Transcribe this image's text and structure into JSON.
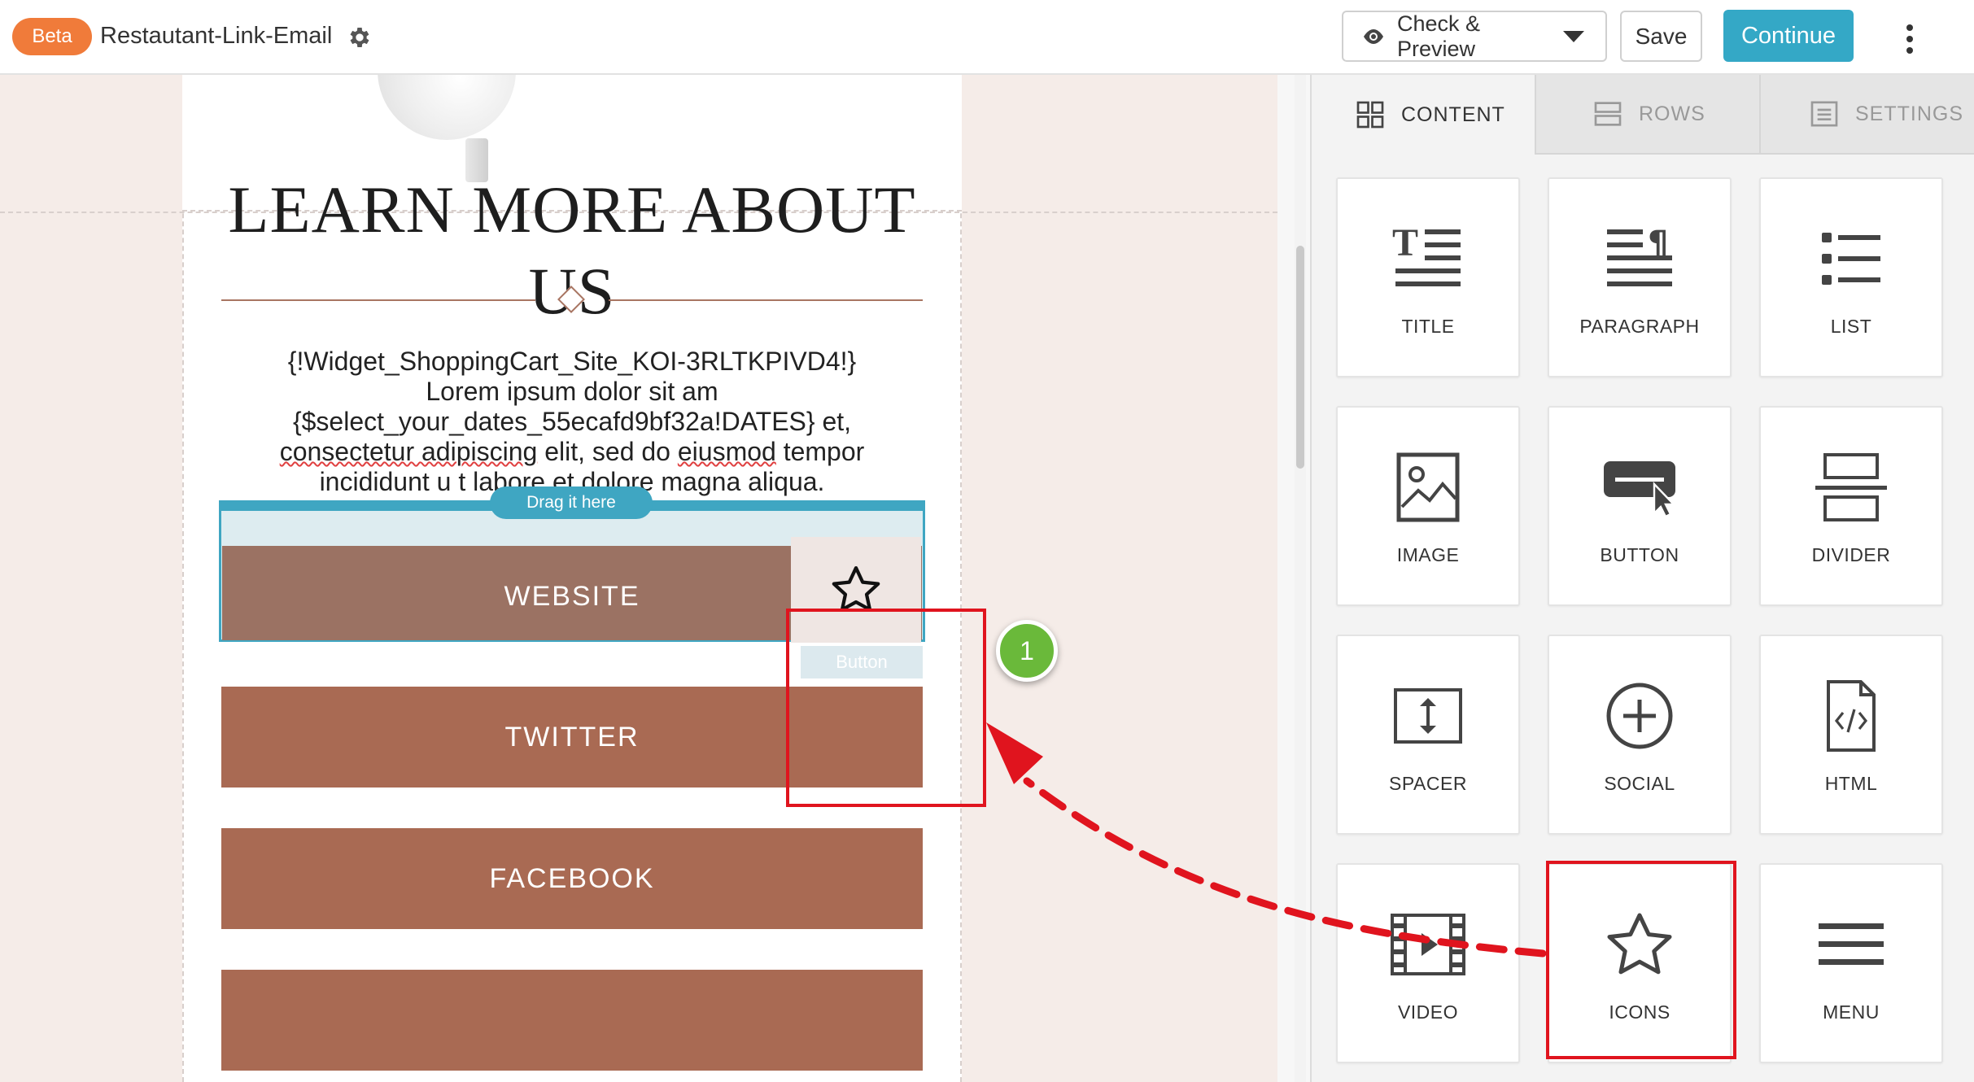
{
  "topbar": {
    "badge": "Beta",
    "title": "Restautant-Link-Email",
    "preview_label": "Check & Preview",
    "save_label": "Save",
    "continue_label": "Continue"
  },
  "email": {
    "heading": "LEARN MORE ABOUT US",
    "paragraph": {
      "line1": "{!Widget_ShoppingCart_Site_KOI-3RLTKPIVD4!}",
      "line2": "Lorem ipsum dolor sit am",
      "line3": "{$select_your_dates_55ecafd9bf32a!DATES} et,",
      "line4a": "consectetur adipiscing",
      "line4b": " elit, sed do ",
      "line4c": "eiusmod",
      "line4d": " tempor",
      "line5": "incididunt u t labore et dolore magna aliqua."
    },
    "drop_hint": "Drag it here",
    "buttons": [
      "WEBSITE",
      "TWITTER",
      "FACEBOOK",
      ""
    ],
    "ghost_label": "Button"
  },
  "annotation": {
    "step": "1"
  },
  "panel": {
    "tabs": [
      "CONTENT",
      "ROWS",
      "SETTINGS"
    ],
    "active_tab": "CONTENT",
    "tiles": [
      {
        "label": "TITLE",
        "icon": "title-icon"
      },
      {
        "label": "PARAGRAPH",
        "icon": "paragraph-icon"
      },
      {
        "label": "LIST",
        "icon": "list-icon"
      },
      {
        "label": "IMAGE",
        "icon": "image-icon"
      },
      {
        "label": "BUTTON",
        "icon": "button-icon"
      },
      {
        "label": "DIVIDER",
        "icon": "divider-icon"
      },
      {
        "label": "SPACER",
        "icon": "spacer-icon"
      },
      {
        "label": "SOCIAL",
        "icon": "social-icon"
      },
      {
        "label": "HTML",
        "icon": "html-icon"
      },
      {
        "label": "VIDEO",
        "icon": "video-icon"
      },
      {
        "label": "ICONS",
        "icon": "star-icon"
      },
      {
        "label": "MENU",
        "icon": "menu-icon"
      }
    ]
  },
  "colors": {
    "accent": "#34a8c6",
    "beta": "#f07b3a",
    "email_button": "#a96a53",
    "highlight": "#e0141e",
    "step_badge": "#6ab93a"
  }
}
